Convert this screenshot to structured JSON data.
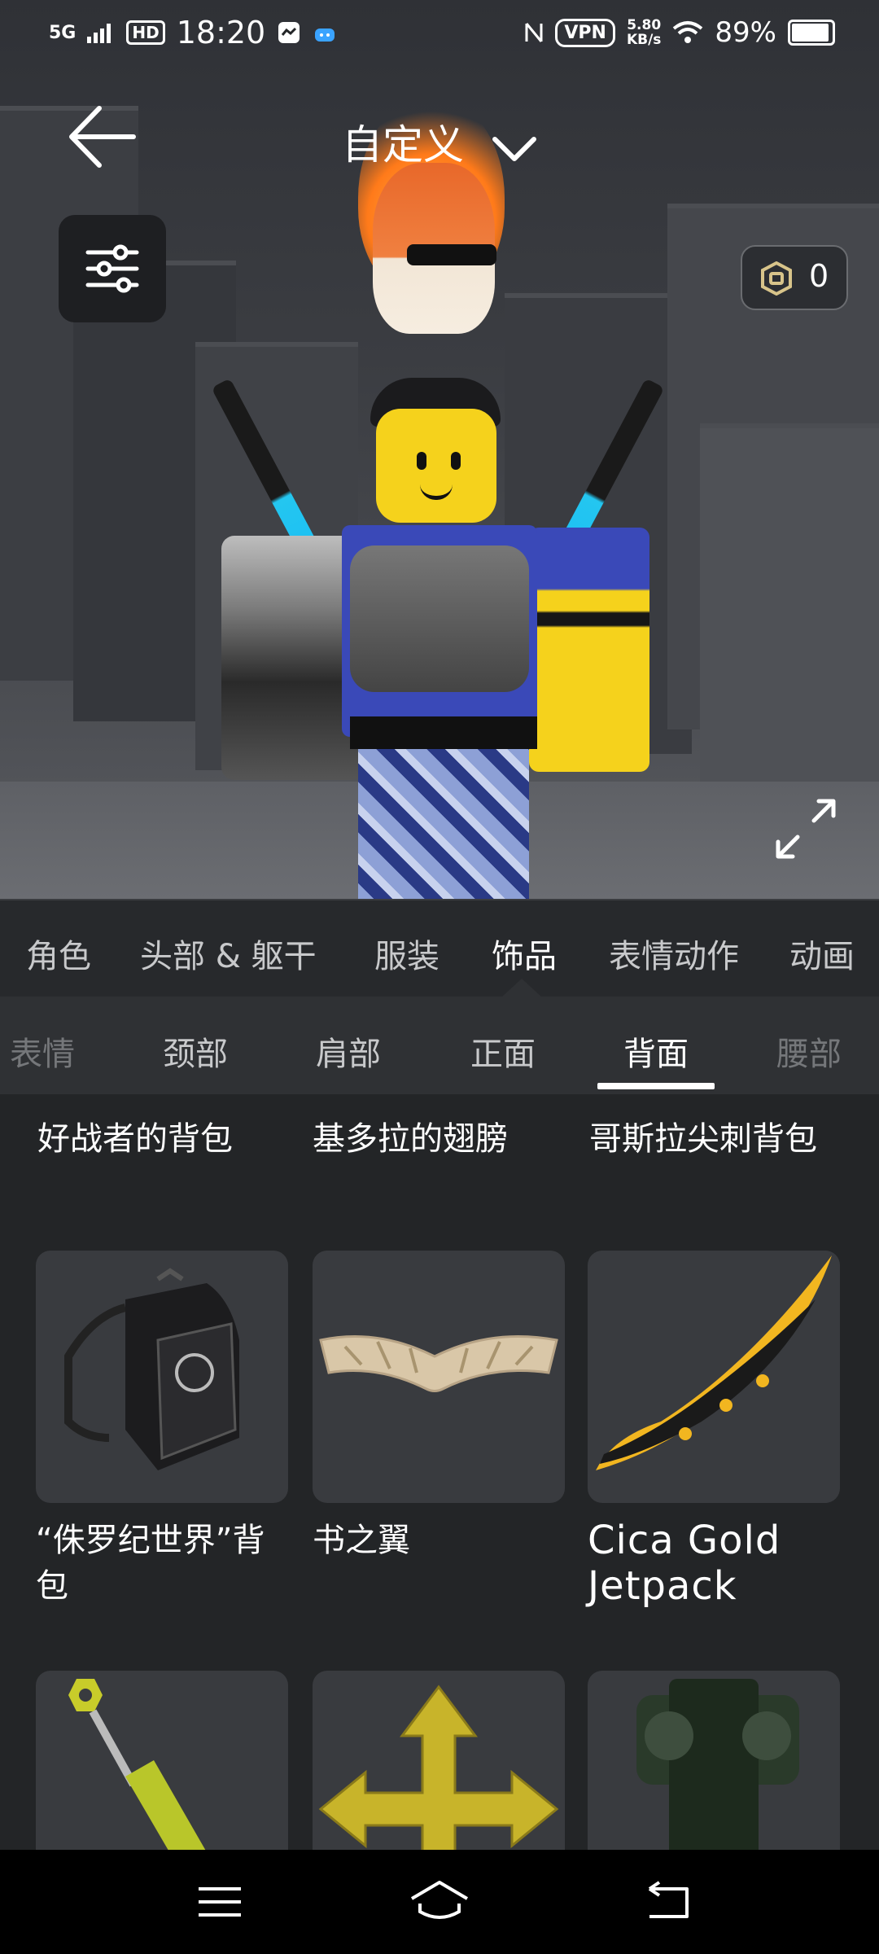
{
  "status_bar": {
    "network": "5G",
    "hd": "HD",
    "time": "18:20",
    "vpn": "VPN",
    "speed_value": "5.80",
    "speed_unit": "KB/s",
    "battery": "89%"
  },
  "header": {
    "title": "自定义",
    "robux_value": "0"
  },
  "category_tabs": [
    {
      "label": "角色"
    },
    {
      "label": "头部 & 躯干"
    },
    {
      "label": "服装"
    },
    {
      "label": "饰品"
    },
    {
      "label": "表情动作"
    },
    {
      "label": "动画"
    }
  ],
  "subcategory_tabs": [
    {
      "label": "表情"
    },
    {
      "label": "颈部"
    },
    {
      "label": "肩部"
    },
    {
      "label": "正面"
    },
    {
      "label": "背面"
    },
    {
      "label": "腰部"
    }
  ],
  "items_top_row": [
    {
      "name": "好战者的背包"
    },
    {
      "name": "基多拉的翅膀"
    },
    {
      "name": "哥斯拉尖刺背包"
    }
  ],
  "items": [
    {
      "name": "“侏罗纪世界”背包",
      "icon": "backpack-icon"
    },
    {
      "name": "书之翼",
      "icon": "paper-wings-icon"
    },
    {
      "name": "Cica Gold Jetpack",
      "icon": "gold-wing-icon"
    },
    {
      "name": "",
      "icon": "key-sword-icon"
    },
    {
      "name": "",
      "icon": "gold-arrows-icon"
    },
    {
      "name": "",
      "icon": "jetpack-icon"
    }
  ],
  "nav": {
    "menu": "menu-icon",
    "home": "home-icon",
    "back": "back-icon"
  },
  "colors": {
    "background": "#232527",
    "tile": "#393b3f",
    "tab_bar": "#27292c",
    "subtab_bar": "#2f3134",
    "accent_blue": "#24c6f0"
  }
}
